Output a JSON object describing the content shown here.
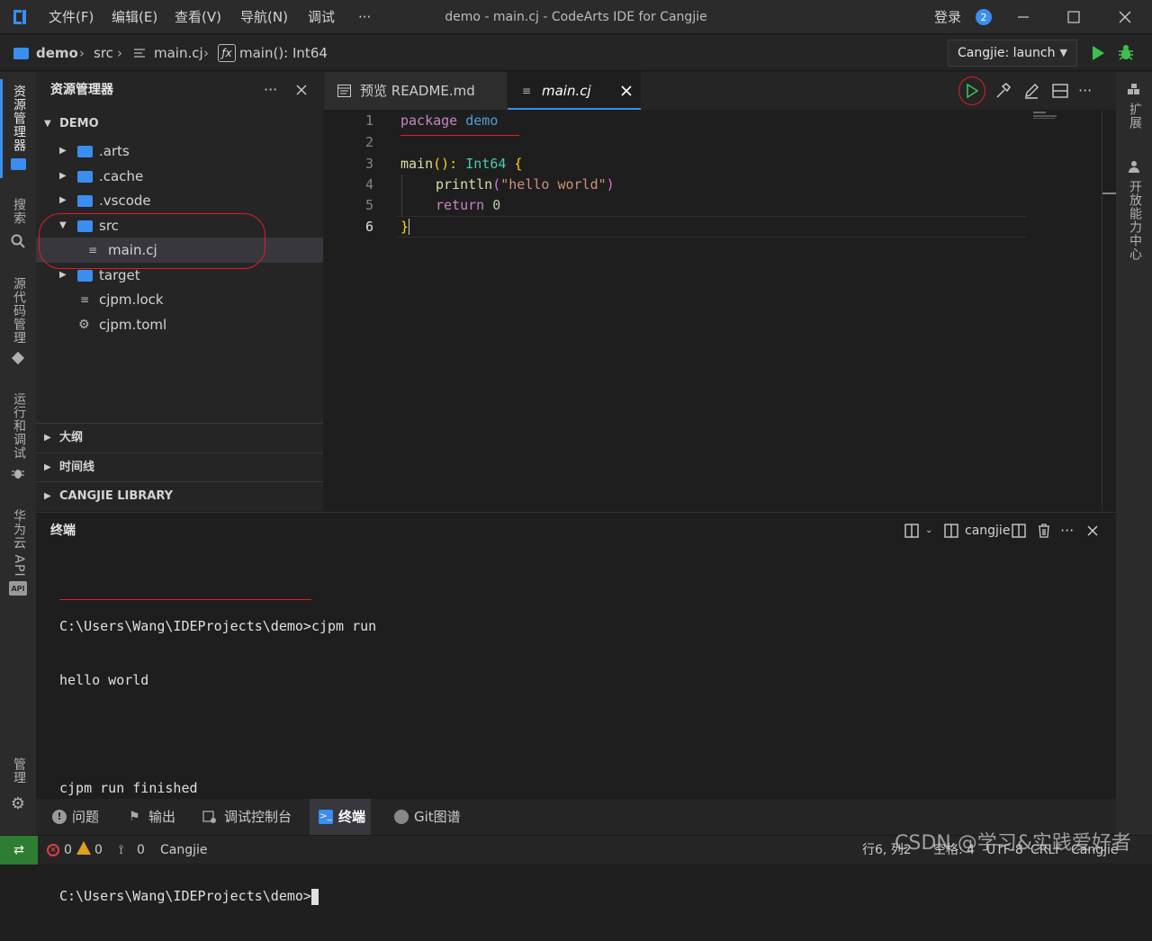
{
  "titlebar": {
    "menus": [
      "文件(F)",
      "编辑(E)",
      "查看(V)",
      "导航(N)",
      "调试",
      "···"
    ],
    "title": "demo - main.cj - CodeArts IDE for Cangjie",
    "login": "登录",
    "badge": "2"
  },
  "breadcrumb": {
    "project": "demo",
    "folder": "src",
    "file": "main.cj",
    "symbol": "main(): Int64"
  },
  "launch": {
    "config": "Cangjie: launch"
  },
  "activity": {
    "explorer": "资源管理器",
    "search": "搜索",
    "scm": "源代码管理",
    "run": "运行和调试",
    "api": "华为云 API",
    "manage": "管理"
  },
  "rightbar": {
    "extensions": "扩展",
    "dev_center": "开放能力中心"
  },
  "sidebar": {
    "title": "资源管理器",
    "root": "DEMO",
    "items": [
      {
        "label": ".arts"
      },
      {
        "label": ".cache"
      },
      {
        "label": ".vscode"
      },
      {
        "label": "src"
      },
      {
        "label": "main.cj"
      },
      {
        "label": "target"
      },
      {
        "label": "cjpm.lock"
      },
      {
        "label": "cjpm.toml"
      }
    ],
    "sections": [
      "大纲",
      "时间线",
      "CANGJIE LIBRARY"
    ]
  },
  "editor": {
    "tabs": [
      {
        "label": "预览 README.md"
      },
      {
        "label": "main.cj"
      }
    ],
    "line_numbers": [
      "1",
      "2",
      "3",
      "4",
      "5",
      "6"
    ],
    "code": {
      "l1_kw": "package",
      "l1_name": "demo",
      "l3_fn": "main",
      "l3_rest": "(): ",
      "l3_type": "Int64",
      "l3_brace": " {",
      "l4_fn": "println",
      "l4_open": "(",
      "l4_str": "\"hello world\"",
      "l4_close": ")",
      "l5_kw": "return",
      "l5_num": "0",
      "l6": "}"
    }
  },
  "panel": {
    "title": "终端",
    "shell": "cangjie",
    "terminal": {
      "line1_prompt": "C:\\Users\\Wang\\IDEProjects\\demo>",
      "line1_cmd": "cjpm run",
      "line2": "hello world",
      "line4": "cjpm run finished",
      "line6_prompt": "C:\\Users\\Wang\\IDEProjects\\demo>"
    }
  },
  "bottomtabs": [
    "问题",
    "输出",
    "调试控制台",
    "终端",
    "Git图谱"
  ],
  "status": {
    "errors": "0",
    "warnings": "0",
    "ports": "0",
    "language": "Cangjie",
    "position": "行6, 列2",
    "spaces": "空格: 4",
    "encoding": "UTF-8",
    "eol": "CRLF",
    "lang_mode": "Cangjie"
  },
  "watermark": "CSDN @学习&实践爱好者",
  "colors": {
    "accent": "#3a8ef0",
    "run_green": "#3fbf4f",
    "annotation_red": "#e02020",
    "keyword": "#c586c0",
    "function": "#dcdcaa",
    "string": "#ce9178",
    "type": "#4ec9b0"
  }
}
